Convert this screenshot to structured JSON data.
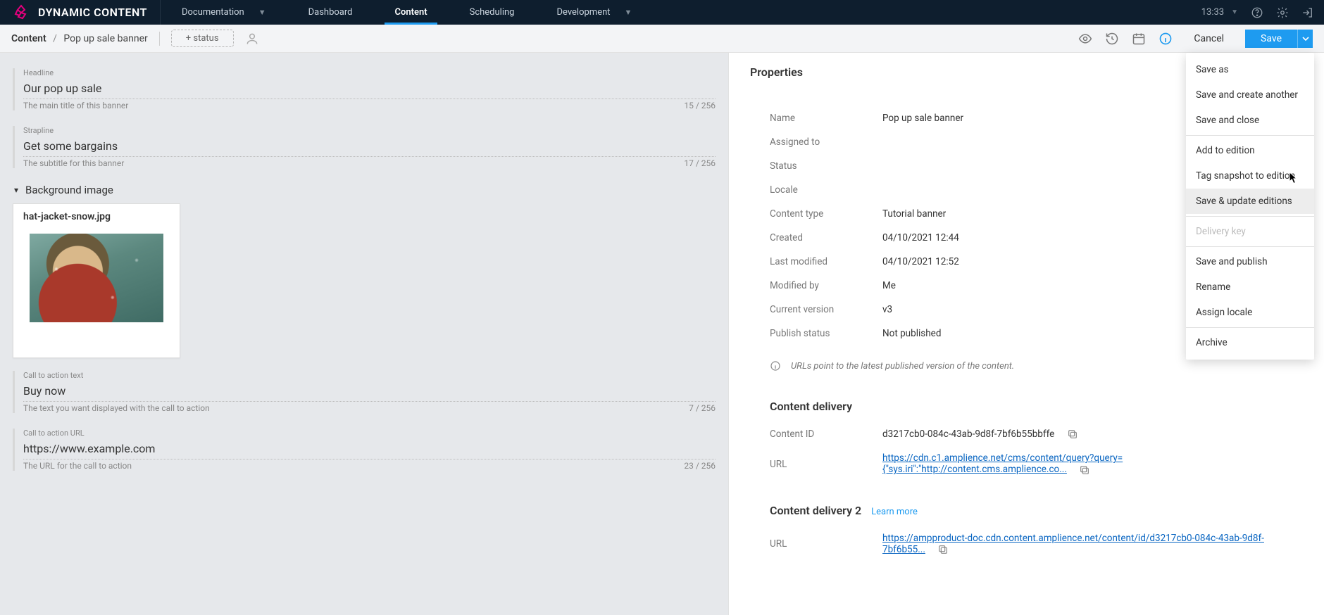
{
  "header": {
    "product_name": "DYNAMIC CONTENT",
    "nav": [
      {
        "label": "Documentation",
        "dropdown": true
      },
      {
        "label": "Dashboard"
      },
      {
        "label": "Content",
        "selected": true
      },
      {
        "label": "Scheduling"
      },
      {
        "label": "Development",
        "dropdown": true
      }
    ],
    "time": "13:33"
  },
  "toolbar": {
    "crumb_root": "Content",
    "crumb_leaf": "Pop up sale banner",
    "status_btn": "+ status",
    "cancel": "Cancel",
    "save": "Save"
  },
  "editor": {
    "headline": {
      "label": "Headline",
      "value": "Our pop up sale",
      "help": "The main title of this banner",
      "count": "15 / 256"
    },
    "strapline": {
      "label": "Strapline",
      "value": "Get some bargains",
      "help": "The subtitle for this banner",
      "count": "17 / 256"
    },
    "bg_section": "Background image",
    "image_filename": "hat-jacket-snow.jpg",
    "cta_text": {
      "label": "Call to action text",
      "value": "Buy now",
      "help": "The text you want displayed with the call to action",
      "count": "7 / 256"
    },
    "cta_url": {
      "label": "Call to action URL",
      "value": "https://www.example.com",
      "help": "The URL for the call to action",
      "count": "23 / 256"
    }
  },
  "properties": {
    "title": "Properties",
    "rows": {
      "name": {
        "k": "Name",
        "v": "Pop up sale banner"
      },
      "assigned": {
        "k": "Assigned to",
        "v": ""
      },
      "status": {
        "k": "Status",
        "v": ""
      },
      "locale": {
        "k": "Locale",
        "v": ""
      },
      "ctype": {
        "k": "Content type",
        "v": "Tutorial banner"
      },
      "created": {
        "k": "Created",
        "v": "04/10/2021 12:44"
      },
      "modified": {
        "k": "Last modified",
        "v": "04/10/2021 12:52"
      },
      "modby": {
        "k": "Modified by",
        "v": "Me"
      },
      "version": {
        "k": "Current version",
        "v": "v3"
      },
      "pubstatus": {
        "k": "Publish status",
        "v": "Not published"
      }
    },
    "hint": "URLs point to the latest published version of the content.",
    "delivery1_title": "Content delivery",
    "content_id_k": "Content ID",
    "content_id_v": "d3217cb0-084c-43ab-9d8f-7bf6b55bbffe",
    "url_k": "URL",
    "url1_v": "https://cdn.c1.amplience.net/cms/content/query?query={\"sys.iri\":\"http://content.cms.amplience.co...",
    "delivery2_title": "Content delivery 2",
    "learn_more": "Learn more",
    "url2_v": "https://ampproduct-doc.cdn.content.amplience.net/content/id/d3217cb0-084c-43ab-9d8f-7bf6b55..."
  },
  "menu": {
    "items": [
      {
        "label": "Save as"
      },
      {
        "label": "Save and create another"
      },
      {
        "label": "Save and close"
      },
      {
        "sep": true
      },
      {
        "label": "Add to edition"
      },
      {
        "label": "Tag snapshot to edition"
      },
      {
        "label": "Save & update editions",
        "hover": true
      },
      {
        "sep": true
      },
      {
        "label": "Delivery key",
        "disabled": true
      },
      {
        "sep": true
      },
      {
        "label": "Save and publish"
      },
      {
        "label": "Rename"
      },
      {
        "label": "Assign locale"
      },
      {
        "sep": true
      },
      {
        "label": "Archive"
      }
    ]
  }
}
